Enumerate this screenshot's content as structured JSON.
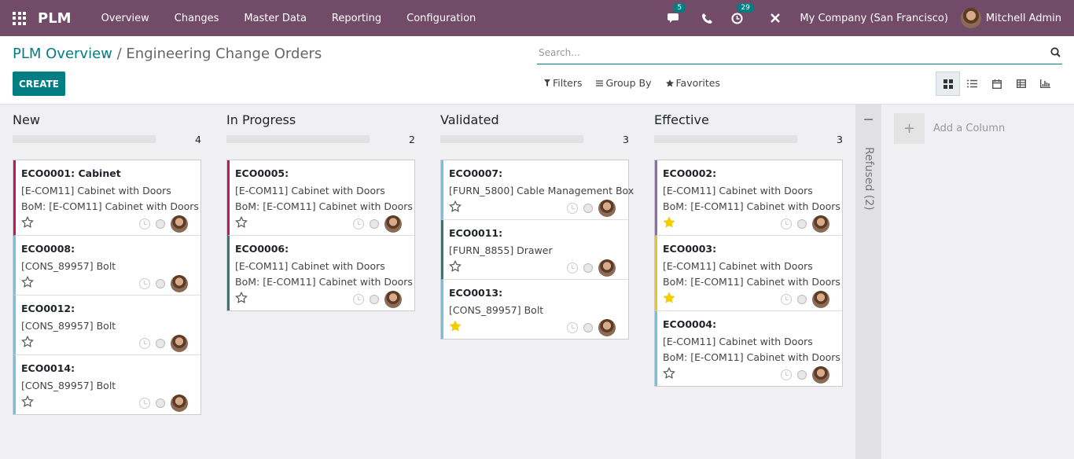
{
  "nav": {
    "brand": "PLM",
    "menu": [
      "Overview",
      "Changes",
      "Master Data",
      "Reporting",
      "Configuration"
    ],
    "messages_badge": "5",
    "activities_badge": "29",
    "company": "My Company (San Francisco)",
    "user": "Mitchell Admin"
  },
  "breadcrumb": {
    "root": "PLM Overview",
    "separator": " / ",
    "current": "Engineering Change Orders"
  },
  "search": {
    "placeholder": "Search..."
  },
  "buttons": {
    "create": "CREATE"
  },
  "filters": {
    "filters": "Filters",
    "group_by": "Group By",
    "favorites": "Favorites"
  },
  "views": [
    "kanban",
    "list",
    "calendar",
    "pivot",
    "graph"
  ],
  "columns": [
    {
      "title": "New",
      "count": "4",
      "cards": [
        {
          "ref": "ECO0001: Cabinet",
          "lines": [
            "[E-COM11] Cabinet with Doors",
            "BoM: [E-COM11] Cabinet with Doors"
          ],
          "color": "#c2185b",
          "starred": false
        },
        {
          "ref": "ECO0008:",
          "lines": [
            "[CONS_89957] Bolt"
          ],
          "color": "#6cc1ed",
          "starred": false
        },
        {
          "ref": "ECO0012:",
          "lines": [
            "[CONS_89957] Bolt"
          ],
          "color": "#6cc1ed",
          "starred": false
        },
        {
          "ref": "ECO0014:",
          "lines": [
            "[CONS_89957] Bolt"
          ],
          "color": "#6cc1ed",
          "starred": false
        }
      ]
    },
    {
      "title": "In Progress",
      "count": "2",
      "cards": [
        {
          "ref": "ECO0005:",
          "lines": [
            "[E-COM11] Cabinet with Doors",
            "BoM: [E-COM11] Cabinet with Doors"
          ],
          "color": "#c2185b",
          "starred": false
        },
        {
          "ref": "ECO0006:",
          "lines": [
            "[E-COM11] Cabinet with Doors",
            "BoM: [E-COM11] Cabinet with Doors"
          ],
          "color": "#2c7a7b",
          "starred": false
        }
      ]
    },
    {
      "title": "Validated",
      "count": "3",
      "cards": [
        {
          "ref": "ECO0007:",
          "lines": [
            "[FURN_5800] Cable Management Box"
          ],
          "color": "#6cc1ed",
          "starred": false
        },
        {
          "ref": "ECO0011:",
          "lines": [
            "[FURN_8855] Drawer"
          ],
          "color": "#2c7a7b",
          "starred": false
        },
        {
          "ref": "ECO0013:",
          "lines": [
            "[CONS_89957] Bolt"
          ],
          "color": "#6cc1ed",
          "starred": true
        }
      ]
    },
    {
      "title": "Effective",
      "count": "3",
      "cards": [
        {
          "ref": "ECO0002:",
          "lines": [
            "[E-COM11] Cabinet with Doors",
            "BoM: [E-COM11] Cabinet with Doors"
          ],
          "color": "#8e6bb8",
          "starred": true
        },
        {
          "ref": "ECO0003:",
          "lines": [
            "[E-COM11] Cabinet with Doors",
            "BoM: [E-COM11] Cabinet with Doors"
          ],
          "color": "#f0c419",
          "starred": true
        },
        {
          "ref": "ECO0004:",
          "lines": [
            "[E-COM11] Cabinet with Doors",
            "BoM: [E-COM11] Cabinet with Doors"
          ],
          "color": "#6cc1ed",
          "starred": false
        }
      ]
    }
  ],
  "folded": {
    "label": "Refused (2)"
  },
  "add_column": "Add a Column"
}
